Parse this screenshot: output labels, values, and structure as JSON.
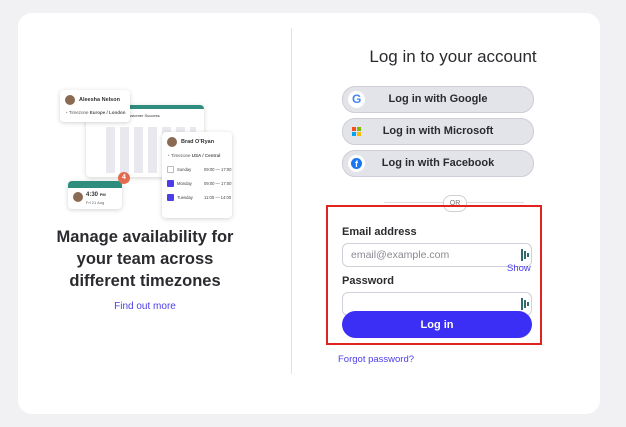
{
  "illustration": {
    "user1_name": "Aleesha Nelson",
    "user1_tz_label": "Timezone",
    "user1_tz": "Europe / London",
    "calendar_title": "Customer Success",
    "user2_name": "Brad O'Ryan",
    "user2_tz_label": "Timezone",
    "user2_tz": "USA / Central",
    "rows": [
      {
        "day": "Sunday",
        "time": "09:00 — 17:00",
        "checked": false
      },
      {
        "day": "Monday",
        "time": "09:00 — 17:00",
        "checked": true
      },
      {
        "day": "Tuesday",
        "time": "11:00 — 14:00",
        "checked": true
      }
    ],
    "time_card_time": "4:30",
    "time_card_period": "PM",
    "time_card_date": "Fri 21 Aug",
    "badge_count": "4"
  },
  "left": {
    "tagline": "Manage availability for your team across different timezones",
    "find_out_more": "Find out more"
  },
  "login": {
    "heading": "Log in to your account",
    "google_label": "Log in with Google",
    "microsoft_label": "Log in with Microsoft",
    "facebook_label": "Log in with Facebook",
    "or_label": "OR",
    "email_label": "Email address",
    "email_placeholder": "email@example.com",
    "email_value": "",
    "password_label": "Password",
    "password_value": "",
    "show_label": "Show",
    "submit_label": "Log in",
    "forgot_label": "Forgot password?"
  },
  "colors": {
    "accent": "#3b2ff5",
    "link": "#4b3ee9",
    "highlight_border": "#e0231f",
    "brand_teal": "#2f8d7e"
  }
}
